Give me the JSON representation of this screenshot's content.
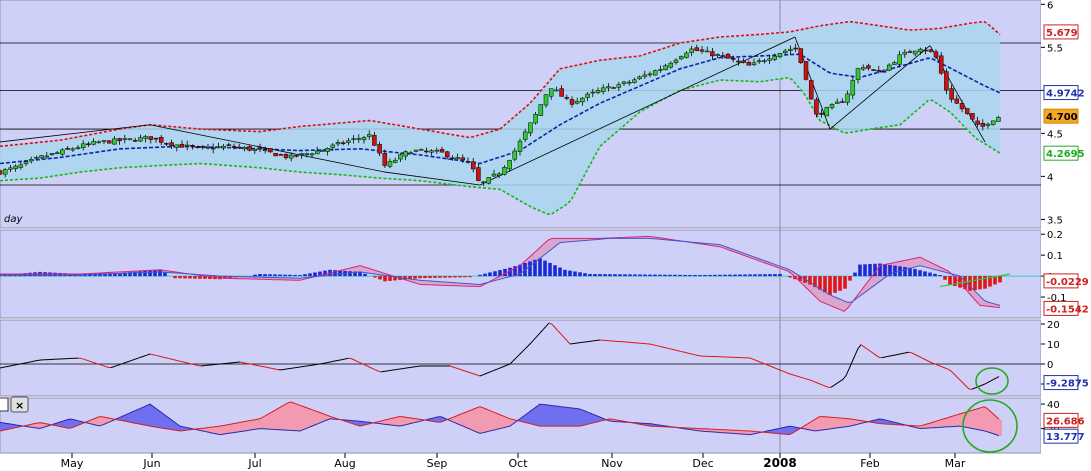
{
  "chart_data": [
    {
      "type": "candlestick",
      "panel": "price",
      "label_fragment": "day",
      "y_ticks": [
        "6",
        "5.5",
        "5",
        "4.5",
        "4",
        "3.5"
      ],
      "y_tick_values": [
        6,
        5.5,
        5,
        4.5,
        4,
        3.5
      ],
      "ylim": [
        3.4,
        6.05
      ],
      "x_ticks": [
        "May",
        "Jun",
        "Jul",
        "Aug",
        "Sep",
        "Oct",
        "Nov",
        "Dec",
        "2008",
        "Feb",
        "Mar"
      ],
      "horizontal_levels": [
        5.55,
        5.0,
        4.55,
        3.9
      ],
      "markers": [
        {
          "label": "5.679",
          "value": 5.679,
          "color": "#cc2222"
        },
        {
          "label": "4.9742",
          "value": 4.9742,
          "color": "#2233aa"
        },
        {
          "label": "4.700",
          "value": 4.7,
          "color": "#cc8800"
        },
        {
          "label": "4.2695",
          "value": 4.2695,
          "color": "#22aa22"
        }
      ],
      "close_keypoints": [
        [
          0,
          4.05
        ],
        [
          20,
          4.12
        ],
        [
          40,
          4.22
        ],
        [
          60,
          4.28
        ],
        [
          80,
          4.35
        ],
        [
          100,
          4.4
        ],
        [
          125,
          4.42
        ],
        [
          150,
          4.45
        ],
        [
          170,
          4.38
        ],
        [
          200,
          4.32
        ],
        [
          230,
          4.35
        ],
        [
          260,
          4.3
        ],
        [
          290,
          4.22
        ],
        [
          320,
          4.3
        ],
        [
          345,
          4.4
        ],
        [
          370,
          4.48
        ],
        [
          385,
          4.12
        ],
        [
          410,
          4.3
        ],
        [
          440,
          4.28
        ],
        [
          470,
          4.15
        ],
        [
          480,
          3.9
        ],
        [
          500,
          4.05
        ],
        [
          515,
          4.3
        ],
        [
          535,
          4.7
        ],
        [
          550,
          5.05
        ],
        [
          570,
          4.85
        ],
        [
          600,
          5.0
        ],
        [
          630,
          5.1
        ],
        [
          660,
          5.25
        ],
        [
          690,
          5.48
        ],
        [
          720,
          5.4
        ],
        [
          750,
          5.28
        ],
        [
          775,
          5.42
        ],
        [
          795,
          5.5
        ],
        [
          805,
          5.2
        ],
        [
          815,
          4.7
        ],
        [
          830,
          4.8
        ],
        [
          845,
          4.9
        ],
        [
          860,
          5.3
        ],
        [
          880,
          5.2
        ],
        [
          900,
          5.4
        ],
        [
          920,
          5.5
        ],
        [
          935,
          5.42
        ],
        [
          948,
          4.95
        ],
        [
          965,
          4.75
        ],
        [
          980,
          4.55
        ],
        [
          990,
          4.65
        ],
        [
          1000,
          4.7
        ]
      ],
      "band_upper": [
        [
          0,
          4.35
        ],
        [
          60,
          4.42
        ],
        [
          120,
          4.55
        ],
        [
          150,
          4.6
        ],
        [
          200,
          4.55
        ],
        [
          260,
          4.52
        ],
        [
          300,
          4.58
        ],
        [
          340,
          4.62
        ],
        [
          370,
          4.65
        ],
        [
          420,
          4.55
        ],
        [
          470,
          4.45
        ],
        [
          500,
          4.55
        ],
        [
          530,
          4.85
        ],
        [
          560,
          5.25
        ],
        [
          600,
          5.35
        ],
        [
          640,
          5.4
        ],
        [
          680,
          5.55
        ],
        [
          720,
          5.62
        ],
        [
          760,
          5.65
        ],
        [
          790,
          5.68
        ],
        [
          820,
          5.75
        ],
        [
          850,
          5.8
        ],
        [
          880,
          5.75
        ],
        [
          910,
          5.7
        ],
        [
          940,
          5.72
        ],
        [
          970,
          5.78
        ],
        [
          985,
          5.8
        ],
        [
          1000,
          5.65
        ]
      ],
      "band_lower": [
        [
          0,
          3.95
        ],
        [
          40,
          3.98
        ],
        [
          80,
          4.05
        ],
        [
          120,
          4.1
        ],
        [
          150,
          4.12
        ],
        [
          200,
          4.15
        ],
        [
          260,
          4.1
        ],
        [
          300,
          4.05
        ],
        [
          340,
          4.02
        ],
        [
          380,
          3.98
        ],
        [
          420,
          3.95
        ],
        [
          470,
          3.88
        ],
        [
          500,
          3.85
        ],
        [
          530,
          3.65
        ],
        [
          550,
          3.55
        ],
        [
          570,
          3.7
        ],
        [
          600,
          4.35
        ],
        [
          640,
          4.75
        ],
        [
          680,
          5.0
        ],
        [
          720,
          5.12
        ],
        [
          760,
          5.1
        ],
        [
          790,
          5.15
        ],
        [
          805,
          4.95
        ],
        [
          820,
          4.65
        ],
        [
          845,
          4.5
        ],
        [
          870,
          4.55
        ],
        [
          900,
          4.6
        ],
        [
          930,
          4.9
        ],
        [
          950,
          4.75
        ],
        [
          975,
          4.45
        ],
        [
          1000,
          4.27
        ]
      ],
      "band_mid": [
        [
          0,
          4.15
        ],
        [
          60,
          4.22
        ],
        [
          120,
          4.32
        ],
        [
          180,
          4.35
        ],
        [
          240,
          4.33
        ],
        [
          300,
          4.3
        ],
        [
          360,
          4.32
        ],
        [
          420,
          4.25
        ],
        [
          480,
          4.15
        ],
        [
          520,
          4.3
        ],
        [
          560,
          4.6
        ],
        [
          600,
          4.85
        ],
        [
          640,
          5.05
        ],
        [
          680,
          5.25
        ],
        [
          720,
          5.38
        ],
        [
          760,
          5.4
        ],
        [
          800,
          5.42
        ],
        [
          830,
          5.2
        ],
        [
          860,
          5.15
        ],
        [
          900,
          5.28
        ],
        [
          930,
          5.38
        ],
        [
          960,
          5.2
        ],
        [
          985,
          5.05
        ],
        [
          1000,
          4.97
        ]
      ],
      "trendlines": [
        {
          "points": [
            [
              0,
              4.4
            ],
            [
              150,
              4.6
            ],
            [
              385,
              4.05
            ],
            [
              480,
              3.9
            ],
            [
              795,
              5.62
            ],
            [
              830,
              4.55
            ],
            [
              930,
              5.52
            ],
            [
              985,
              4.4
            ]
          ]
        }
      ]
    },
    {
      "type": "histogram-line",
      "panel": "macd",
      "y_ticks": [
        "0.2",
        "0.1",
        "0",
        "-0.1"
      ],
      "y_tick_values": [
        0.2,
        0.1,
        0,
        -0.1
      ],
      "ylim": [
        -0.2,
        0.22
      ],
      "markers": [
        {
          "label": "-0.0229",
          "value": -0.0229,
          "color": "#cc2222"
        },
        {
          "label": "-0.1542",
          "value": -0.1542,
          "color": "#cc2222"
        }
      ],
      "hist_keypoints": [
        [
          0,
          0.005
        ],
        [
          40,
          0.02
        ],
        [
          80,
          0.01
        ],
        [
          120,
          0.015
        ],
        [
          160,
          0.03
        ],
        [
          175,
          -0.01
        ],
        [
          220,
          -0.015
        ],
        [
          260,
          0.01
        ],
        [
          300,
          0.005
        ],
        [
          330,
          0.03
        ],
        [
          360,
          0.02
        ],
        [
          385,
          -0.025
        ],
        [
          420,
          -0.01
        ],
        [
          470,
          -0.005
        ],
        [
          510,
          0.04
        ],
        [
          540,
          0.085
        ],
        [
          565,
          0.03
        ],
        [
          590,
          0.01
        ],
        [
          700,
          0.005
        ],
        [
          780,
          0.01
        ],
        [
          810,
          -0.04
        ],
        [
          830,
          -0.09
        ],
        [
          845,
          -0.06
        ],
        [
          860,
          0.055
        ],
        [
          880,
          0.06
        ],
        [
          910,
          0.04
        ],
        [
          940,
          0.005
        ],
        [
          950,
          -0.04
        ],
        [
          970,
          -0.07
        ],
        [
          985,
          -0.06
        ],
        [
          1000,
          -0.03
        ]
      ],
      "line1_keypoints": [
        [
          0,
          0.01
        ],
        [
          80,
          0.01
        ],
        [
          160,
          0.03
        ],
        [
          220,
          -0.01
        ],
        [
          300,
          -0.02
        ],
        [
          360,
          0.05
        ],
        [
          420,
          -0.04
        ],
        [
          480,
          -0.05
        ],
        [
          520,
          0.05
        ],
        [
          550,
          0.18
        ],
        [
          600,
          0.18
        ],
        [
          650,
          0.19
        ],
        [
          720,
          0.14
        ],
        [
          790,
          0.02
        ],
        [
          820,
          -0.12
        ],
        [
          845,
          -0.17
        ],
        [
          880,
          0.05
        ],
        [
          920,
          0.09
        ],
        [
          950,
          0.02
        ],
        [
          980,
          -0.14
        ],
        [
          1000,
          -0.15
        ]
      ],
      "line2_keypoints": [
        [
          0,
          0.005
        ],
        [
          80,
          0.005
        ],
        [
          160,
          0.02
        ],
        [
          220,
          0.0
        ],
        [
          300,
          -0.01
        ],
        [
          360,
          0.02
        ],
        [
          420,
          -0.02
        ],
        [
          480,
          -0.04
        ],
        [
          520,
          0.01
        ],
        [
          560,
          0.16
        ],
        [
          610,
          0.18
        ],
        [
          650,
          0.18
        ],
        [
          720,
          0.15
        ],
        [
          790,
          0.03
        ],
        [
          830,
          -0.09
        ],
        [
          850,
          -0.13
        ],
        [
          890,
          0.01
        ],
        [
          920,
          0.05
        ],
        [
          960,
          0.0
        ],
        [
          985,
          -0.12
        ],
        [
          1000,
          -0.14
        ]
      ],
      "signal_line": [
        [
          940,
          -0.05
        ],
        [
          1010,
          0.01
        ]
      ]
    },
    {
      "type": "line",
      "panel": "oscillator",
      "y_ticks": [
        "20",
        "10",
        "0",
        "-10"
      ],
      "y_tick_values": [
        20,
        10,
        0,
        -10
      ],
      "ylim": [
        -16,
        22
      ],
      "markers": [
        {
          "label": "-9.2875",
          "value": -9.2875,
          "color": "#2233aa"
        }
      ],
      "line_keypoints": [
        [
          0,
          -2
        ],
        [
          40,
          2
        ],
        [
          80,
          3
        ],
        [
          110,
          -2
        ],
        [
          150,
          5
        ],
        [
          200,
          -1
        ],
        [
          240,
          1
        ],
        [
          280,
          -3
        ],
        [
          320,
          0
        ],
        [
          350,
          3
        ],
        [
          380,
          -4
        ],
        [
          420,
          -1
        ],
        [
          450,
          -1
        ],
        [
          480,
          -6
        ],
        [
          510,
          0
        ],
        [
          530,
          10
        ],
        [
          550,
          21
        ],
        [
          570,
          10
        ],
        [
          600,
          12
        ],
        [
          650,
          10
        ],
        [
          700,
          4
        ],
        [
          750,
          3
        ],
        [
          790,
          -5
        ],
        [
          810,
          -8
        ],
        [
          830,
          -12
        ],
        [
          845,
          -7
        ],
        [
          860,
          10
        ],
        [
          880,
          3
        ],
        [
          910,
          6
        ],
        [
          930,
          1
        ],
        [
          950,
          -3
        ],
        [
          970,
          -13
        ],
        [
          985,
          -10
        ],
        [
          1000,
          -6
        ]
      ]
    },
    {
      "type": "area",
      "panel": "directional",
      "y_ticks": [
        "40",
        "20"
      ],
      "y_tick_values": [
        40,
        20
      ],
      "ylim": [
        0,
        45
      ],
      "markers": [
        {
          "label": "26.686",
          "value": 26.686,
          "color": "#cc2222"
        },
        {
          "label": "13.777",
          "value": 13.777,
          "color": "#2233aa"
        }
      ],
      "series": [
        {
          "keypoints": [
            [
              0,
              25
            ],
            [
              40,
              20
            ],
            [
              70,
              28
            ],
            [
              100,
              22
            ],
            [
              150,
              40
            ],
            [
              180,
              22
            ],
            [
              220,
              15
            ],
            [
              260,
              20
            ],
            [
              300,
              18
            ],
            [
              330,
              28
            ],
            [
              360,
              26
            ],
            [
              400,
              22
            ],
            [
              440,
              30
            ],
            [
              480,
              16
            ],
            [
              510,
              22
            ],
            [
              540,
              40
            ],
            [
              580,
              36
            ],
            [
              610,
              26
            ],
            [
              650,
              24
            ],
            [
              700,
              18
            ],
            [
              750,
              15
            ],
            [
              790,
              22
            ],
            [
              815,
              18
            ],
            [
              850,
              22
            ],
            [
              880,
              28
            ],
            [
              920,
              20
            ],
            [
              960,
              22
            ],
            [
              985,
              18
            ],
            [
              1000,
              14
            ]
          ]
        },
        {
          "keypoints": [
            [
              0,
              18
            ],
            [
              40,
              25
            ],
            [
              70,
              20
            ],
            [
              100,
              30
            ],
            [
              150,
              22
            ],
            [
              180,
              18
            ],
            [
              220,
              22
            ],
            [
              260,
              28
            ],
            [
              290,
              42
            ],
            [
              330,
              30
            ],
            [
              360,
              22
            ],
            [
              400,
              30
            ],
            [
              440,
              25
            ],
            [
              480,
              38
            ],
            [
              510,
              28
            ],
            [
              540,
              22
            ],
            [
              580,
              22
            ],
            [
              610,
              28
            ],
            [
              650,
              22
            ],
            [
              700,
              20
            ],
            [
              750,
              18
            ],
            [
              790,
              15
            ],
            [
              820,
              30
            ],
            [
              850,
              28
            ],
            [
              880,
              24
            ],
            [
              920,
              22
            ],
            [
              960,
              32
            ],
            [
              985,
              38
            ],
            [
              1000,
              27
            ]
          ]
        }
      ]
    }
  ]
}
